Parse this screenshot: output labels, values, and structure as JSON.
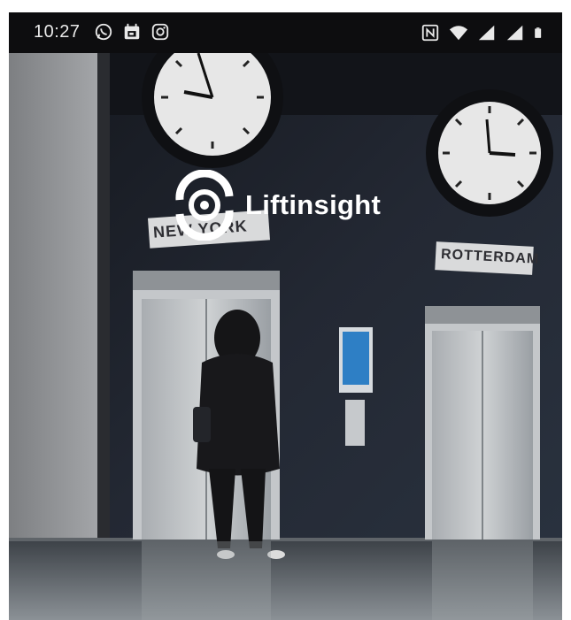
{
  "status_bar": {
    "time": "10:27",
    "left_icons": [
      "whatsapp-icon",
      "calendar-icon",
      "instagram-icon"
    ],
    "right_icons": [
      "nfc-icon",
      "wifi-icon",
      "signal-icon",
      "signal-icon",
      "battery-icon"
    ]
  },
  "logo": {
    "name": "Liftinsight",
    "icon": "liftinsight-logo-icon"
  },
  "signs": {
    "left": "NEW YORK",
    "right": "ROTTERDAM"
  },
  "colors": {
    "status_bar_bg": "#0d0d0f",
    "logo_text": "#ffffff",
    "wall": "#1c2028"
  }
}
